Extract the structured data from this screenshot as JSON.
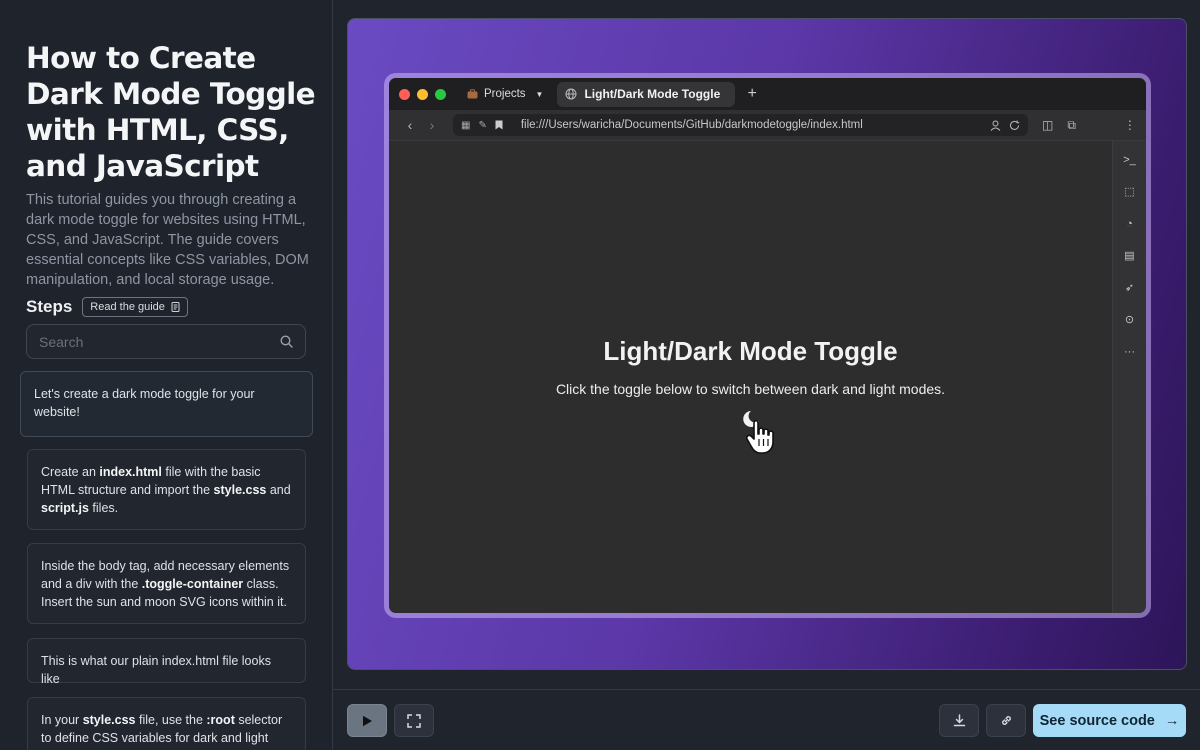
{
  "tutorial": {
    "title": "How to Create Dark Mode Toggle with HTML, CSS, and JavaScript",
    "description": "This tutorial guides you through creating a dark mode toggle for websites using HTML, CSS, and JavaScript. The guide covers essential concepts like CSS variables, DOM manipulation, and local storage usage."
  },
  "steps": {
    "label": "Steps",
    "guide_button": "Read the guide",
    "search_placeholder": "Search",
    "items": [
      {
        "parts": [
          [
            "",
            "Let's create a dark mode toggle for your website!"
          ]
        ]
      },
      {
        "parts": [
          [
            "",
            "Create an "
          ],
          [
            "b",
            "index.html"
          ],
          [
            "",
            " file with the basic HTML structure and import the "
          ],
          [
            "b",
            "style.css"
          ],
          [
            "",
            " and "
          ],
          [
            "b",
            "script.js"
          ],
          [
            "",
            " files."
          ]
        ]
      },
      {
        "parts": [
          [
            "",
            "Inside the body tag, add necessary elements and a div with the "
          ],
          [
            "b",
            ".toggle-container"
          ],
          [
            "",
            " class. Insert the sun and moon SVG icons within it."
          ]
        ]
      },
      {
        "parts": [
          [
            "",
            "This is what our plain index.html file looks like"
          ]
        ]
      },
      {
        "parts": [
          [
            "",
            "In your "
          ],
          [
            "b",
            "style.css"
          ],
          [
            "",
            " file, use the "
          ],
          [
            "b",
            ":root"
          ],
          [
            "",
            " selector to define CSS variables for dark and light colors."
          ]
        ]
      }
    ]
  },
  "browser": {
    "tab_group": "Projects",
    "tab_title": "Light/Dark Mode Toggle",
    "url": "file:///Users/waricha/Documents/GitHub/darkmodetoggle/index.html",
    "page_heading": "Light/Dark Mode Toggle",
    "page_text": "Click the toggle below to switch between dark and light modes."
  },
  "bottom_bar": {
    "source_button": "See source code",
    "source_arrow": "→"
  },
  "colors": {
    "accent": "#a5dbf7",
    "traffic_red": "#fe5f57",
    "traffic_yellow": "#febc2e",
    "traffic_green": "#28c840"
  },
  "icons": [
    "search-icon",
    "document-icon",
    "play-icon",
    "fullscreen-icon",
    "download-icon",
    "link-icon",
    "arrow-right-icon",
    "moon-icon",
    "hand-cursor-icon"
  ]
}
